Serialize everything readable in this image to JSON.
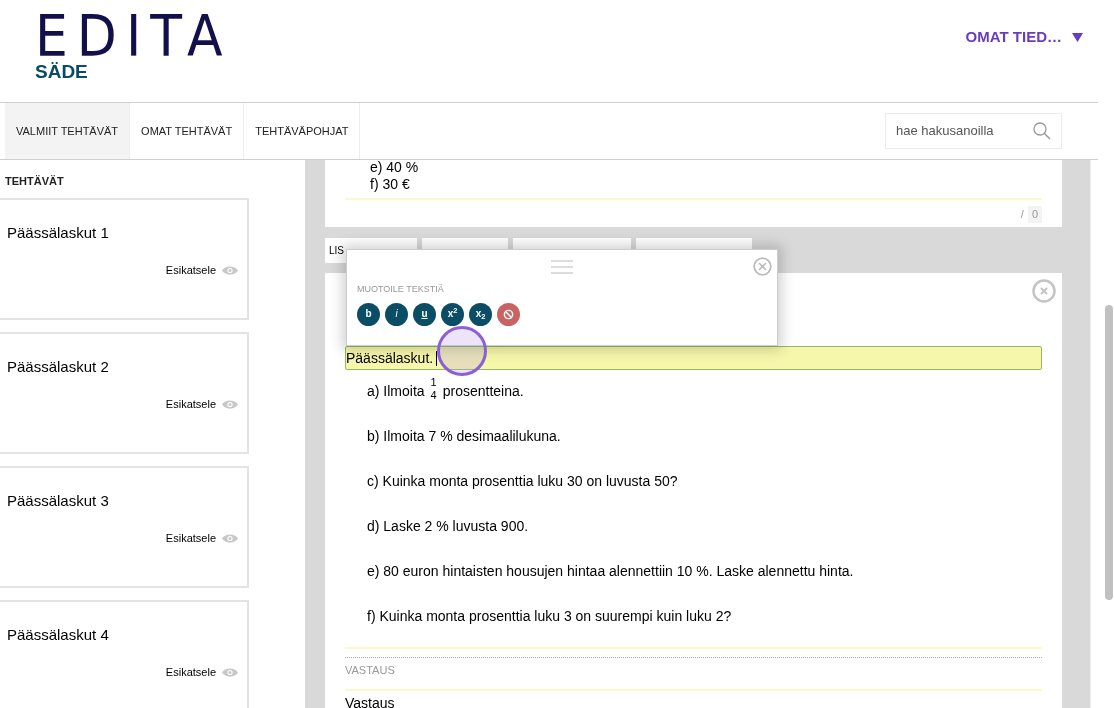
{
  "header": {
    "logo_top": "EDITA",
    "logo_bottom": "SÄDE",
    "user_menu": "OMAT TIED…"
  },
  "nav": {
    "tabs": [
      {
        "label": "VALMIIT TEHTÄVÄT",
        "selected": true
      },
      {
        "label": "OMAT TEHTÄVÄT",
        "selected": false
      },
      {
        "label": "TEHTÄVÄPOHJAT",
        "selected": false
      }
    ],
    "search": {
      "placeholder": "hae hakusanoilla"
    }
  },
  "sidebar": {
    "heading": "TEHTÄVÄT",
    "items": [
      {
        "title": "Päässälaskut 1",
        "action": "Esikatsele"
      },
      {
        "title": "Päässälaskut 2",
        "action": "Esikatsele"
      },
      {
        "title": "Päässälaskut 3",
        "action": "Esikatsele"
      },
      {
        "title": "Päässälaskut 4",
        "action": "Esikatsele"
      }
    ]
  },
  "previous_block": {
    "lines": [
      "e) 40 %",
      "f) 30 €"
    ],
    "score_separator": "/",
    "score": "0"
  },
  "add_buttons": [
    {
      "label": "LIS"
    }
  ],
  "format_popup": {
    "heading": "MUOTOILE TEKSTIÄ",
    "buttons": [
      {
        "kind": "bold",
        "label": "b"
      },
      {
        "kind": "italic",
        "label": "i"
      },
      {
        "kind": "underline",
        "label": "u"
      },
      {
        "kind": "superscript",
        "label": "x$^{2}$"
      },
      {
        "kind": "subscript",
        "label": "x$_{2}$"
      },
      {
        "kind": "clear"
      }
    ]
  },
  "editor": {
    "title_value": "Päässälaskut.",
    "items": [
      {
        "parts": [
          {
            "kind": "text",
            "text": "a) Ilmoita"
          },
          {
            "kind": "fraction",
            "numerator": "1",
            "denominator": "4"
          },
          {
            "kind": "text",
            "text": "prosentteina."
          }
        ]
      },
      {
        "parts": [
          {
            "kind": "text",
            "text": "b) Ilmoita 7 % desimaalilukuna."
          }
        ]
      },
      {
        "parts": [
          {
            "kind": "text",
            "text": "c) Kuinka monta prosenttia luku 30 on luvusta 50?"
          }
        ]
      },
      {
        "parts": [
          {
            "kind": "text",
            "text": "d) Laske 2 % luvusta 900."
          }
        ]
      },
      {
        "parts": [
          {
            "kind": "text",
            "text": "e) 80 euron hintaisten housujen hintaa alennettiin 10 %. Laske alennettu hinta."
          }
        ]
      },
      {
        "parts": [
          {
            "kind": "text",
            "text": "f) Kuinka monta prosenttia luku 3 on suurempi kuin luku 2?"
          }
        ]
      }
    ],
    "answer_label": "VASTAUS",
    "answer_value": "Vastaus"
  }
}
